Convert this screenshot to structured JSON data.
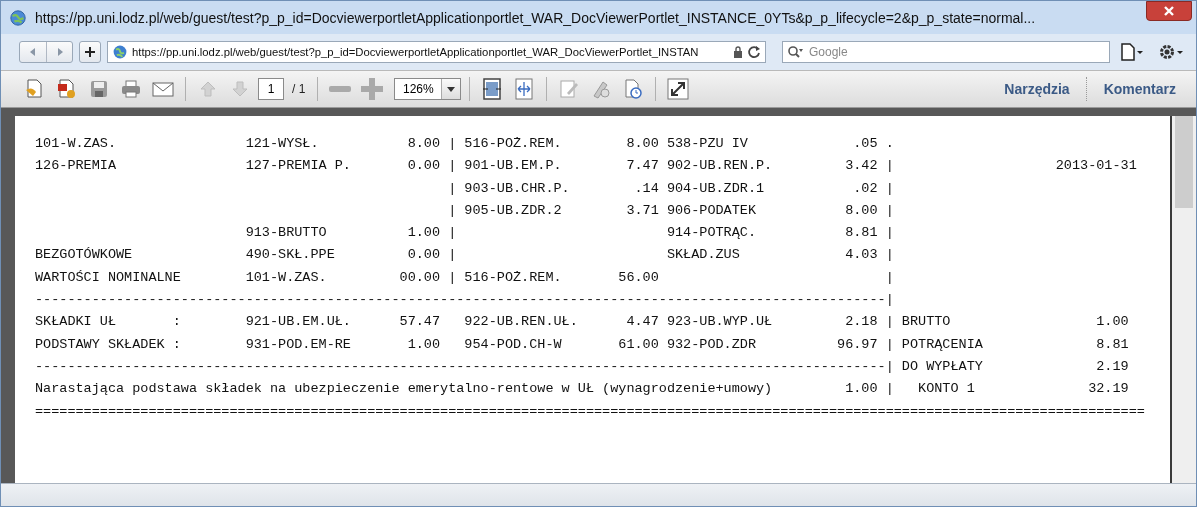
{
  "window": {
    "title": "https://pp.uni.lodz.pl/web/guest/test?p_p_id=DocviewerportletApplicationportlet_WAR_DocViewerPortlet_INSTANCE_0YTs&p_p_lifecycle=2&p_p_state=normal..."
  },
  "address_bar": {
    "url": "https://pp.uni.lodz.pl/web/guest/test?p_p_id=DocviewerportletApplicationportlet_WAR_DocViewerPortlet_INSTAN",
    "search_placeholder": "Google"
  },
  "pdf_toolbar": {
    "nav_buttons": [
      {
        "kind": "up",
        "disabled": true
      },
      {
        "kind": "down",
        "disabled": true
      }
    ],
    "page": "1",
    "page_count": "/ 1",
    "zoom": "126%",
    "panels": [
      "Narzędzia",
      "Komentarz"
    ]
  },
  "document": {
    "lines": [
      "101-W.ZAS.                121-WYSŁ.           8.00 | 516-POŻ.REM.        8.00 538-PZU IV             .05 .",
      "126-PREMIA                127-PREMIA P.       0.00 | 901-UB.EM.P.        7.47 902-UB.REN.P.         3.42 |                    2013-01-31",
      "                                                   | 903-UB.CHR.P.        .14 904-UB.ZDR.1           .02 |",
      "                                                   | 905-UB.ZDR.2        3.71 906-PODATEK           8.00 |",
      "                          913-BRUTTO          1.00 |                          914-POTRĄC.           8.81 |",
      "BEZGOTÓWKOWE              490-SKŁ.PPE         0.00 |                          SKŁAD.ZUS             4.03 |",
      "WARTOŚCI NOMINALNE        101-W.ZAS.         00.00 | 516-POŻ.REM.       56.00                            |",
      "---------------------------------------------------------------------------------------------------------|",
      "SKŁADKI UŁ       :        921-UB.EM.UŁ.      57.47   922-UB.REN.UŁ.      4.47 923-UB.WYP.UŁ         2.18 | BRUTTO                  1.00",
      "PODSTAWY SKŁADEK :        931-POD.EM-RE       1.00   954-POD.CH-W       61.00 932-POD.ZDR          96.97 | POTRĄCENIA              8.81",
      "---------------------------------------------------------------------------------------------------------| DO WYPŁATY              2.19",
      "Narastająca podstawa składek na ubezpieczenie emerytalno-rentowe w UŁ (wynagrodzenie+umowy)         1.00 |   KONTO 1              32.19",
      "========================================================================================================================================="
    ]
  }
}
